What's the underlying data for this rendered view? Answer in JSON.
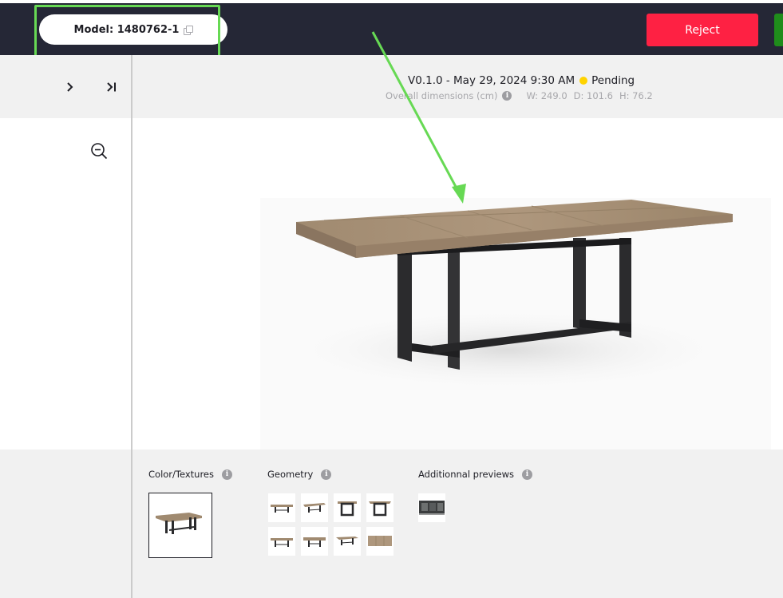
{
  "header": {
    "model_label": "Model: 1480762-1",
    "reject_label": "Reject",
    "accent_reject": "#fe2143",
    "accent_approve": "#1f8d1b",
    "highlight_color": "#67d954"
  },
  "version": {
    "text": "V0.1.0 - May 29, 2024 9:30 AM",
    "status": "Pending",
    "status_color": "#ffd300"
  },
  "dimensions": {
    "label": "Overall dimensions (cm)",
    "width": "W: 249.0",
    "depth": "D: 101.6",
    "height": "H: 76.2"
  },
  "icons": {
    "expand": "chevron-right-icon",
    "expand_all": "expand-to-end-icon",
    "zoom_out": "zoom-out-icon",
    "copy": "copy-icon",
    "info": "info-icon"
  },
  "sections": {
    "color_textures": "Color/Textures",
    "geometry": "Geometry",
    "additional_previews": "Additionnal previews"
  }
}
